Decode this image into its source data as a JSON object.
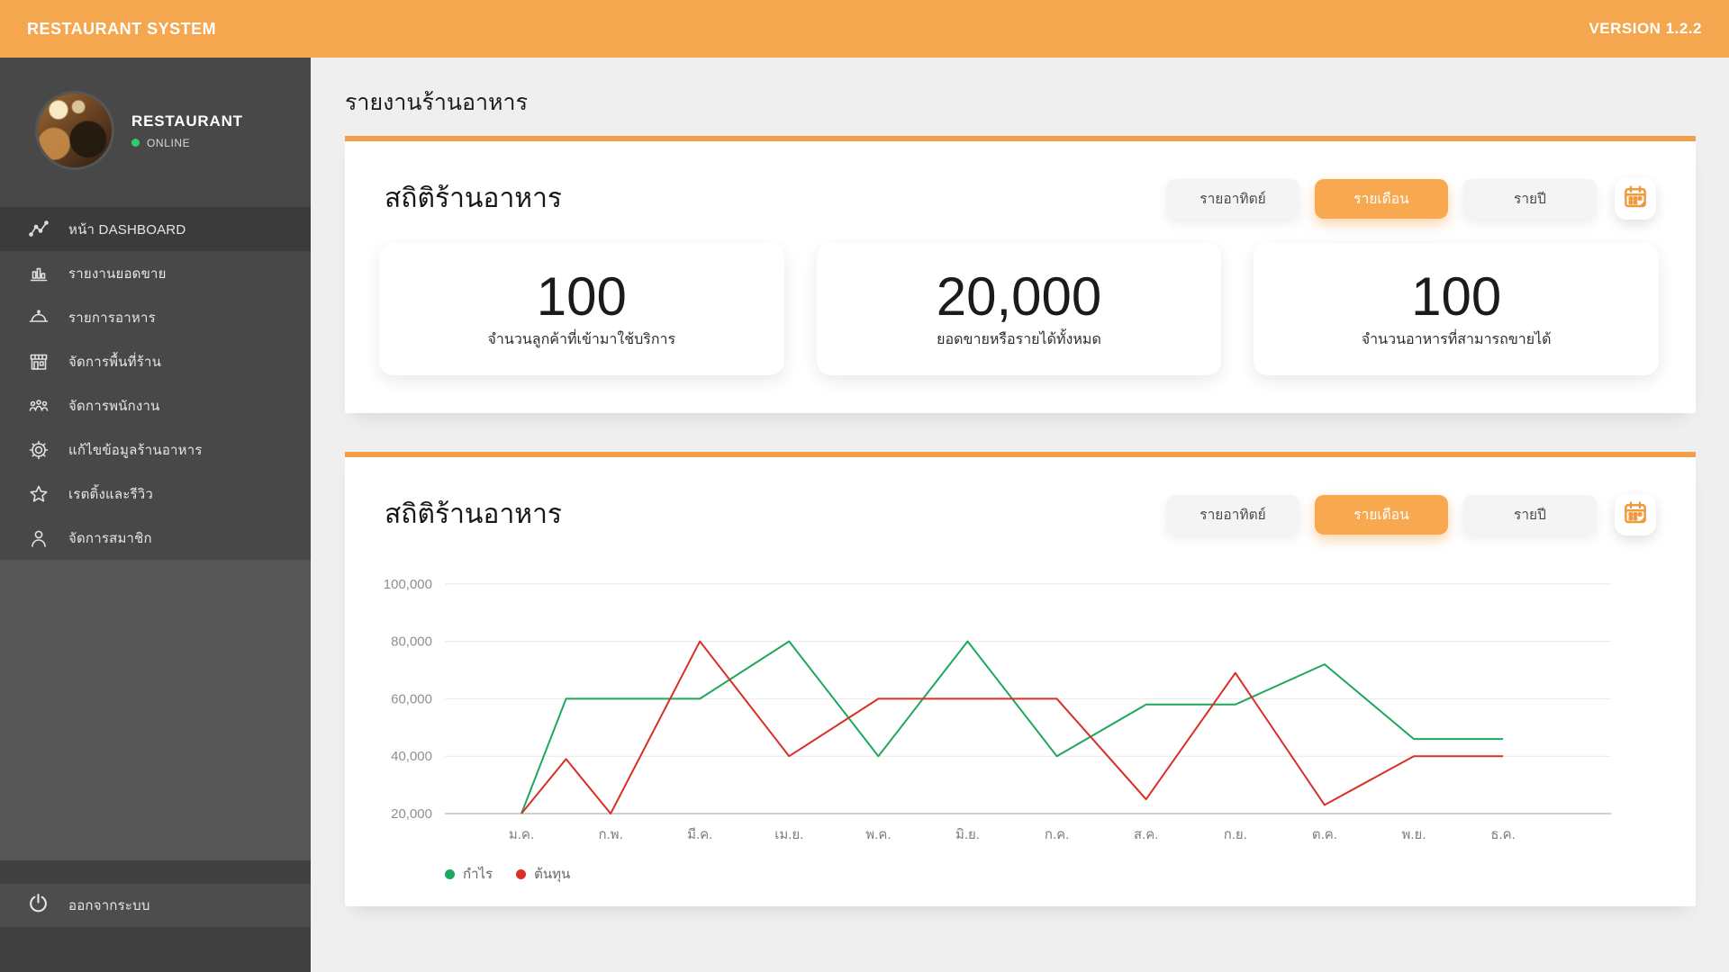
{
  "app": {
    "title": "RESTAURANT SYSTEM",
    "version": "VERSION 1.2.2"
  },
  "sidebar": {
    "profile": {
      "name": "RESTAURANT",
      "status": "ONLINE"
    },
    "menu": [
      {
        "icon": "dashboard-icon",
        "label": "หน้า DASHBOARD",
        "active": true
      },
      {
        "icon": "bar-chart-icon",
        "label": "รายงานยอดขาย",
        "active": false
      },
      {
        "icon": "cloche-icon",
        "label": "รายการอาหาร",
        "active": false
      },
      {
        "icon": "storefront-icon",
        "label": "จัดการพื้นที่ร้าน",
        "active": false
      },
      {
        "icon": "staff-icon",
        "label": "จัดการพนักงาน",
        "active": false
      },
      {
        "icon": "gear-icon",
        "label": "แก้ไขข้อมูลร้านอาหาร",
        "active": false
      },
      {
        "icon": "star-icon",
        "label": "เรตติ้งและรีวิว",
        "active": false
      },
      {
        "icon": "member-icon",
        "label": "จัดการสมาชิก",
        "active": false
      }
    ],
    "logout_label": "ออกจากระบบ"
  },
  "main": {
    "page_title": "รายงานร้านอาหาร",
    "section_stats": {
      "title": "สถิติร้านอาหาร",
      "period_buttons": [
        {
          "label": "รายอาทิตย์",
          "active": false
        },
        {
          "label": "รายเดือน",
          "active": true
        },
        {
          "label": "รายปี",
          "active": false
        }
      ],
      "stats": [
        {
          "value": "100",
          "label": "จำนวนลูกค้าที่เข้ามาใช้บริการ"
        },
        {
          "value": "20,000",
          "label": "ยอดขายหรือรายได้ทั้งหมด"
        },
        {
          "value": "100",
          "label": "จำนวนอาหารที่สามารถขายได้"
        }
      ]
    },
    "section_chart": {
      "title": "สถิติร้านอาหาร",
      "period_buttons": [
        {
          "label": "รายอาทิตย์",
          "active": false
        },
        {
          "label": "รายเดือน",
          "active": true
        },
        {
          "label": "รายปี",
          "active": false
        }
      ]
    }
  },
  "chart_data": {
    "type": "line",
    "categories": [
      "ม.ค.",
      "ก.พ.",
      "มี.ค.",
      "เม.ย.",
      "พ.ค.",
      "มิ.ย.",
      "ก.ค.",
      "ส.ค.",
      "ก.ย.",
      "ต.ค.",
      "พ.ย.",
      "ธ.ค."
    ],
    "ylim": [
      20000,
      100000
    ],
    "yticks": [
      20000,
      40000,
      60000,
      80000,
      100000
    ],
    "grid": true,
    "legend_position": "bottom-left",
    "series": [
      {
        "name": "กำไร",
        "color": "#1FA75D",
        "points": [
          [
            1,
            20000
          ],
          [
            1.5,
            60000
          ],
          [
            2,
            60000
          ],
          [
            3,
            60000
          ],
          [
            4,
            80000
          ],
          [
            5,
            40000
          ],
          [
            6,
            80000
          ],
          [
            7,
            40000
          ],
          [
            8,
            58000
          ],
          [
            9,
            58000
          ],
          [
            10,
            72000
          ],
          [
            11,
            46000
          ],
          [
            12,
            46000
          ]
        ]
      },
      {
        "name": "ต้นทุน",
        "color": "#D93025",
        "points": [
          [
            1,
            20000
          ],
          [
            1.5,
            39000
          ],
          [
            2,
            20000
          ],
          [
            3,
            80000
          ],
          [
            4,
            40000
          ],
          [
            5,
            60000
          ],
          [
            6,
            60000
          ],
          [
            7,
            60000
          ],
          [
            8,
            25000
          ],
          [
            9,
            69000
          ],
          [
            10,
            23000
          ],
          [
            11,
            40000
          ],
          [
            12,
            40000
          ]
        ]
      }
    ]
  },
  "colors": {
    "topbar": "#F4A74E",
    "accent": "#F19F4A",
    "active_button": "#F8A94F",
    "sidebar": "#484848",
    "online": "#2ECC71",
    "profit": "#1FA75D",
    "cost": "#D93025"
  }
}
